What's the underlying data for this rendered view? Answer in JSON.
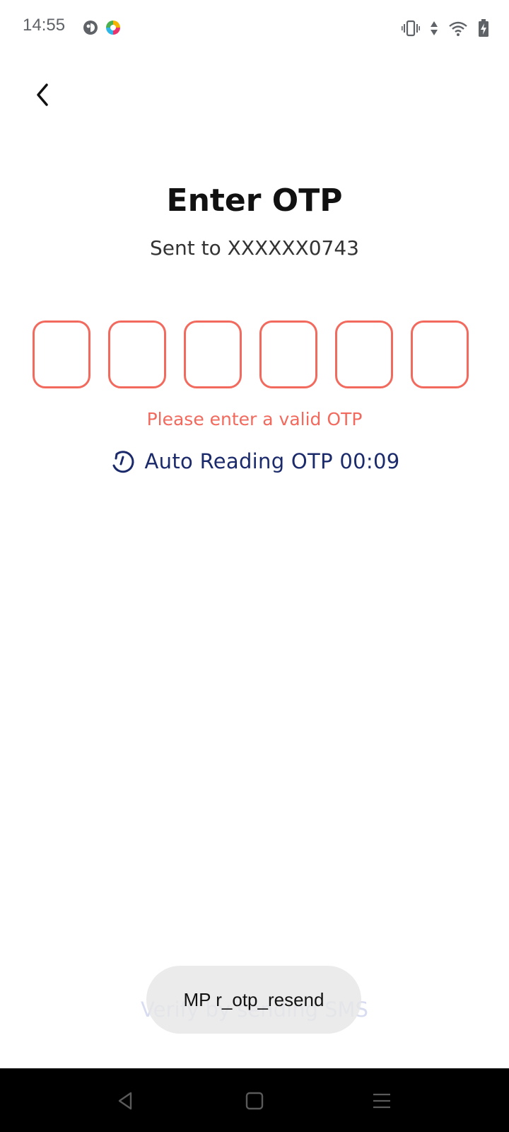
{
  "status_bar": {
    "time": "14:55",
    "icons": [
      "vibrate-icon",
      "data-arrows-icon",
      "wifi-icon",
      "battery-charging-icon"
    ]
  },
  "header": {
    "back_icon": "chevron-left-icon",
    "title": "Enter OTP",
    "subtitle": "Sent to XXXXXX0743"
  },
  "otp": {
    "digits": [
      "",
      "",
      "",
      "",
      "",
      ""
    ],
    "error": "Please enter a valid OTP",
    "auto_read_label": "Auto Reading OTP 00:09",
    "accent_color": "#f26a5d"
  },
  "footer": {
    "verify_sms_label": "Verify by sending SMS"
  },
  "toast": {
    "text": "MP r_otp_resend"
  },
  "nav_bar": {
    "icons": [
      "back-triangle-icon",
      "home-square-icon",
      "menu-lines-icon"
    ]
  }
}
